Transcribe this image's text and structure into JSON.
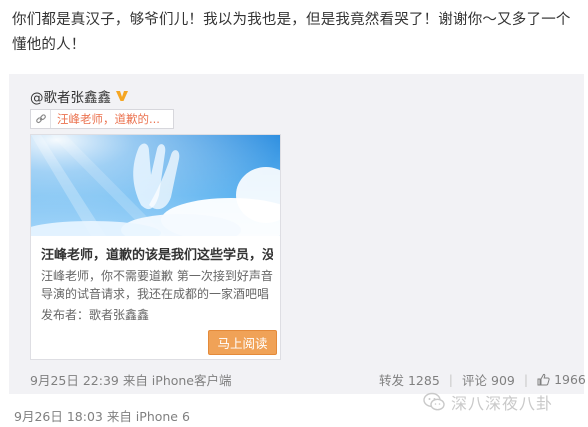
{
  "post": {
    "text": "你们都是真汉子，够爷们儿！我以为我也是，但是我竟然看哭了！谢谢你～又多了一个懂他的人！"
  },
  "retweet": {
    "author": "@歌者张鑫鑫",
    "link_chip": "汪峰老师，道歉的...",
    "card": {
      "title": "汪峰老师，道歉的该是我们这些学员，没...",
      "desc_line1": "汪峰老师，你不需要道歉 第一次接到好声音",
      "desc_line2": "导演的试音请求，我还在成都的一家酒吧唱",
      "publisher": "发布者：歌者张鑫鑫",
      "read_button": "马上阅读"
    },
    "time_source": "9月25日 22:39 来自 iPhone客户端",
    "repost": "转发 1285",
    "comment": "评论 909",
    "likes": "1966"
  },
  "post_meta": {
    "time_source": "9月26日 18:03 来自 iPhone 6"
  },
  "watermark": {
    "text": "深八深夜八卦"
  },
  "icons": {
    "verify": "verified-v-icon",
    "link": "link-icon",
    "like": "thumbs-up-icon",
    "wechat": "wechat-icon"
  },
  "colors": {
    "link_orange": "#eb7350",
    "button_orange": "#f0a257",
    "meta_gray": "#808080",
    "panel_bg": "#f2f2f5"
  }
}
